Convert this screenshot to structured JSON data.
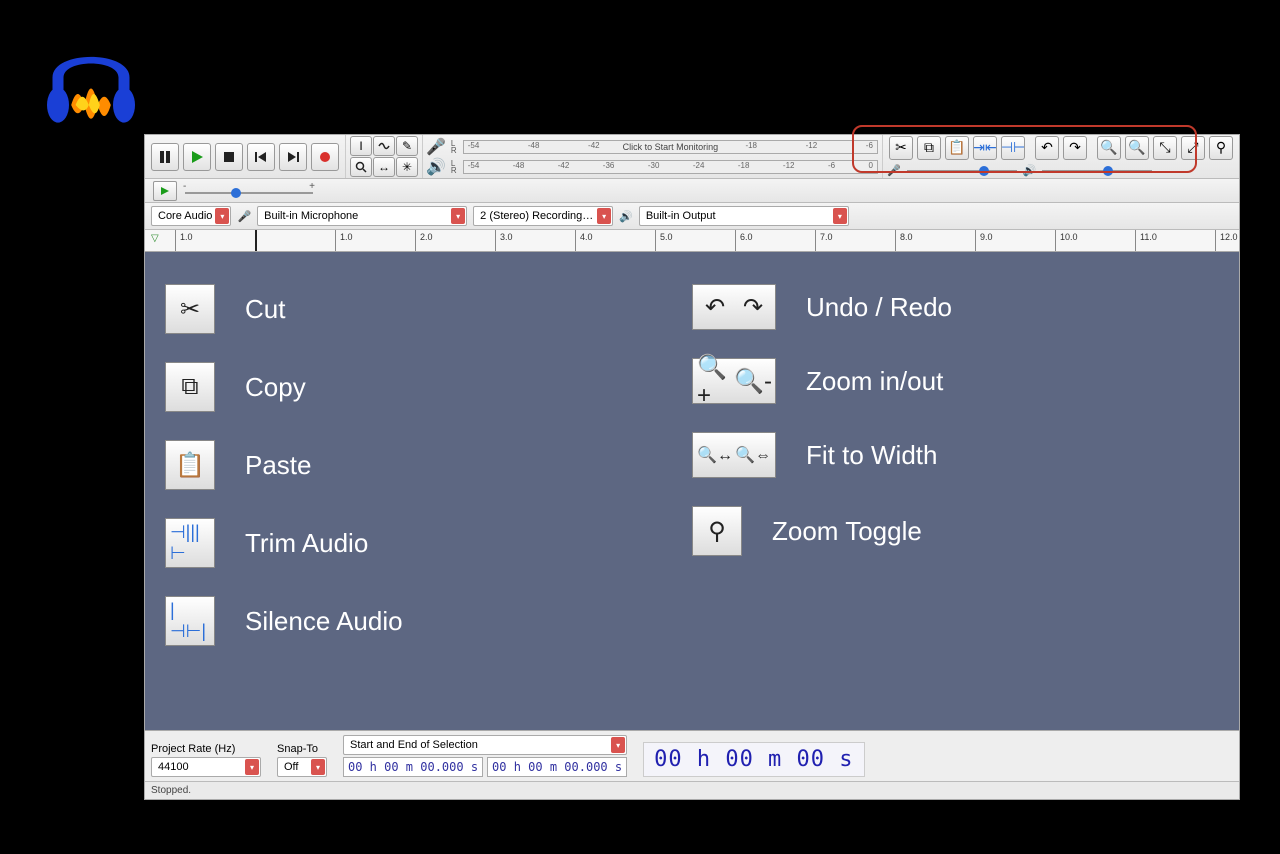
{
  "logo_hint": "Audacity application icon (headphones over orange waveform)",
  "transport": {
    "tooltip": "Transport controls"
  },
  "meters": {
    "rec_placeholder": "Click to Start Monitoring",
    "rec_ticks": [
      "-54",
      "-48",
      "-42",
      "",
      "",
      "-18",
      "-12",
      "-6"
    ],
    "play_ticks": [
      "-54",
      "-48",
      "-42",
      "-36",
      "-30",
      "-24",
      "-18",
      "-12",
      "-6",
      "0"
    ],
    "channels": [
      "L",
      "R"
    ]
  },
  "device_bar": {
    "host": "Core Audio",
    "input": "Built-in Microphone",
    "channels": "2 (Stereo) Recording…",
    "output": "Built-in Output"
  },
  "ruler_ticks": [
    "1.0",
    "",
    "1.0",
    "2.0",
    "3.0",
    "4.0",
    "5.0",
    "6.0",
    "7.0",
    "8.0",
    "9.0",
    "10.0",
    "11.0",
    "12.0"
  ],
  "legend_left": [
    {
      "label": "Cut",
      "icon": "cut"
    },
    {
      "label": "Copy",
      "icon": "copy"
    },
    {
      "label": "Paste",
      "icon": "paste"
    },
    {
      "label": "Trim Audio",
      "icon": "trim"
    },
    {
      "label": "Silence Audio",
      "icon": "silence"
    }
  ],
  "legend_right": [
    {
      "label": "Undo / Redo",
      "icon": "undo-redo",
      "double": true
    },
    {
      "label": "Zoom in/out",
      "icon": "zoom-inout",
      "double": true
    },
    {
      "label": "Fit to Width",
      "icon": "fit-width",
      "double": true
    },
    {
      "label": "Zoom Toggle",
      "icon": "zoom-toggle"
    }
  ],
  "bottom": {
    "project_rate_label": "Project Rate (Hz)",
    "project_rate": "44100",
    "snap_label": "Snap-To",
    "snap": "Off",
    "sel_label": "Start and End of Selection",
    "time1": "00 h 00 m 00.000 s",
    "time2": "00 h 00 m 00.000 s",
    "bigtime": "00 h 00 m 00 s"
  },
  "status": "Stopped.",
  "slider_minus": "-",
  "slider_plus": "+"
}
